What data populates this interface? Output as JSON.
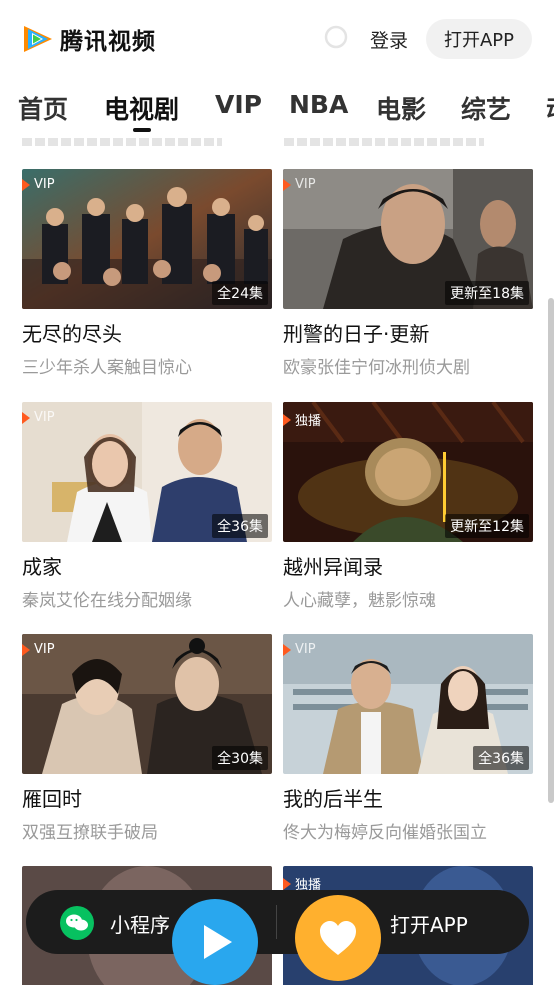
{
  "header": {
    "logo_text": "腾讯视频",
    "login_label": "登录",
    "open_app_label": "打开APP"
  },
  "tabs": [
    {
      "label": "首页"
    },
    {
      "label": "电视剧",
      "active": true
    },
    {
      "label": "VIP"
    },
    {
      "label": "NBA"
    },
    {
      "label": "电影"
    },
    {
      "label": "综艺"
    },
    {
      "label": "动"
    }
  ],
  "cards": [
    {
      "badge": "VIP",
      "episodes": "全24集",
      "title": "无尽的尽头",
      "subtitle": "三少年杀人案触目惊心"
    },
    {
      "badge": "VIP",
      "episodes": "更新至18集",
      "title": "刑警的日子·更新",
      "subtitle": "欧豪张佳宁何冰刑侦大剧"
    },
    {
      "badge": "VIP",
      "episodes": "全36集",
      "title": "成家",
      "subtitle": "秦岚艾伦在线分配姻缘"
    },
    {
      "badge": "独播",
      "episodes": "更新至12集",
      "title": "越州异闻录",
      "subtitle": "人心藏孽，魅影惊魂"
    },
    {
      "badge": "VIP",
      "episodes": "全30集",
      "title": "雁回时",
      "subtitle": "双强互撩联手破局"
    },
    {
      "badge": "VIP",
      "episodes": "全36集",
      "title": "我的后半生",
      "subtitle": "佟大为梅婷反向催婚张国立"
    },
    {
      "badge": "",
      "episodes": "",
      "title": "",
      "subtitle": ""
    },
    {
      "badge": "独播",
      "episodes": "",
      "title": "",
      "subtitle": ""
    }
  ],
  "bottom_bar": {
    "mini_program_label": "小程序",
    "open_app_label": "打开APP"
  },
  "colors": {
    "accent_orange": "#ff5a1f",
    "play_blue": "#29a7ee",
    "heart_yellow": "#ffb02e",
    "wechat_green": "#07c160"
  }
}
